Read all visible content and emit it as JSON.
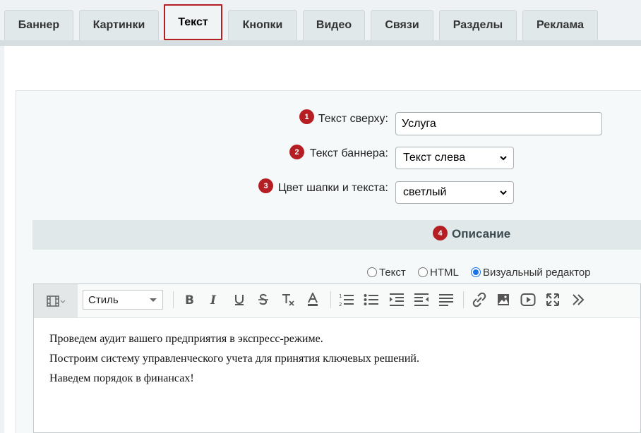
{
  "tabs": [
    {
      "label": "Баннер",
      "active": false
    },
    {
      "label": "Картинки",
      "active": false
    },
    {
      "label": "Текст",
      "active": true
    },
    {
      "label": "Кнопки",
      "active": false
    },
    {
      "label": "Видео",
      "active": false
    },
    {
      "label": "Связи",
      "active": false
    },
    {
      "label": "Разделы",
      "active": false
    },
    {
      "label": "Реклама",
      "active": false
    }
  ],
  "fields": {
    "top_text": {
      "badge": "1",
      "label": "Текст сверху:",
      "value": "Услуга"
    },
    "banner_text": {
      "badge": "2",
      "label": "Текст баннера:",
      "selected": "Текст слева"
    },
    "header_color": {
      "badge": "3",
      "label": "Цвет шапки и текста:",
      "selected": "светлый"
    }
  },
  "description": {
    "badge": "4",
    "title": "Описание",
    "modes": [
      {
        "label": "Текст",
        "checked": false
      },
      {
        "label": "HTML",
        "checked": false
      },
      {
        "label": "Визуальный редактор",
        "checked": true
      }
    ]
  },
  "editor": {
    "style_label": "Стиль",
    "toolbar_icons": [
      "source-icon",
      "bold-icon",
      "italic-icon",
      "underline-icon",
      "strikethrough-icon",
      "remove-format-icon",
      "text-color-icon",
      "ordered-list-icon",
      "bullet-list-icon",
      "indent-icon",
      "outdent-icon",
      "align-icon",
      "link-icon",
      "image-icon",
      "video-icon",
      "fullscreen-icon",
      "more-icon"
    ],
    "content": [
      "Проведем аудит вашего предприятия в экспресс-режиме.",
      "Построим систему управленческого учета для принятия ключевых решений.",
      "Наведем порядок в финансах!"
    ]
  },
  "colors": {
    "accent": "#b51f24",
    "radio": "#1a73e8",
    "section_bg": "#e0e8ea"
  }
}
